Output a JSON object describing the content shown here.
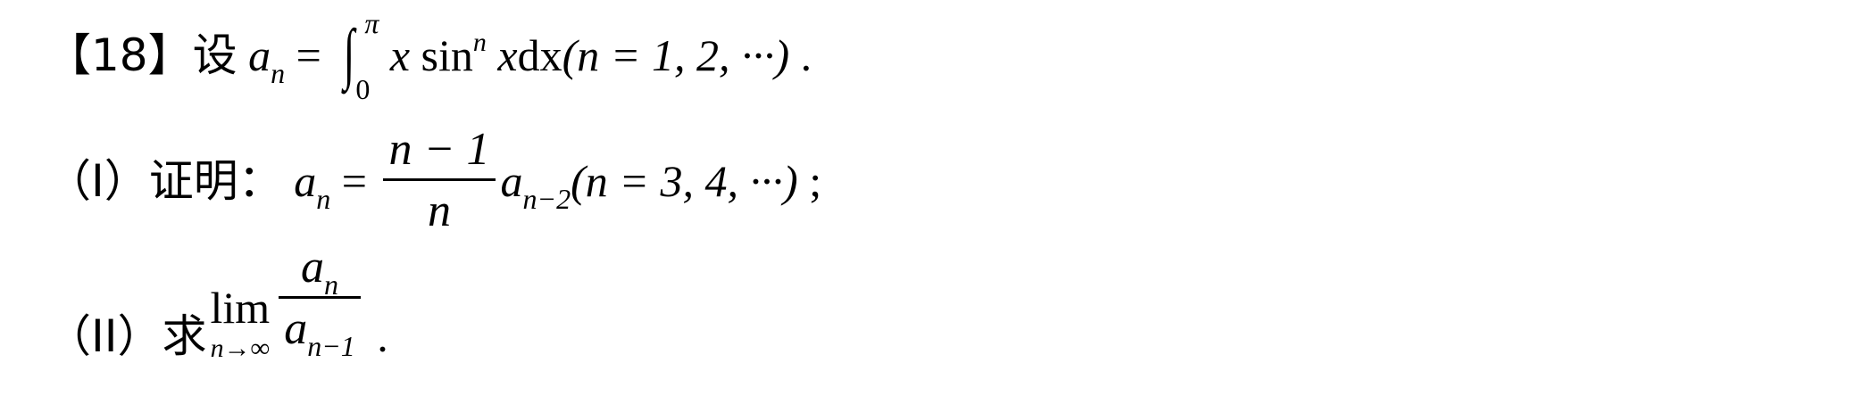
{
  "problem": {
    "number_label": "【18】",
    "intro_word": "设",
    "definition": {
      "a": "a",
      "n": "n",
      "equals": " = ",
      "upper_limit": "π",
      "lower_limit": "0",
      "integrand_x": "x",
      "sin": "sin",
      "power": "n",
      "differential": "dx",
      "range": "(n = 1, 2, ···)",
      "end": " ."
    },
    "part1": {
      "label": "（I）证明：",
      "lhs_a": "a",
      "lhs_sub": "n",
      "equals": " = ",
      "numerator": "n − 1",
      "denominator": "n",
      "rhs_a": "a",
      "rhs_sub": "n−2",
      "range": "(n = 3, 4, ···)",
      "end": " ;"
    },
    "part2": {
      "label": "（II）求",
      "lim_word": "lim",
      "lim_under": "n→∞",
      "numerator_a": "a",
      "numerator_sub": "n",
      "denominator_a": "a",
      "denominator_sub": "n−1",
      "end": " ."
    }
  }
}
